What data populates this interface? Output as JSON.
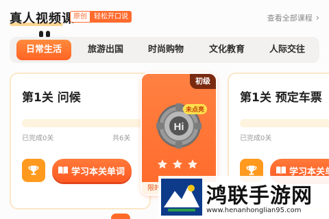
{
  "header": {
    "title": "真人视频课",
    "tag_original": "原创",
    "tag_slogan": "轻松开口说",
    "view_all": "查看全部课程"
  },
  "tabs": [
    {
      "label": "日常生活",
      "active": true
    },
    {
      "label": "旅游出国",
      "active": false
    },
    {
      "label": "时尚购物",
      "active": false
    },
    {
      "label": "文化教育",
      "active": false
    },
    {
      "label": "人际交往",
      "active": false
    }
  ],
  "lessons": [
    {
      "title": "第1关  问候",
      "progress": 0,
      "done_text": "已完成0关",
      "total_text": "共6关",
      "study_label": "学习本关单词"
    },
    {
      "title": "第1关  预定车票",
      "progress": 0,
      "done_text": "已完成0关",
      "study_label": "学习本关单"
    }
  ],
  "level_card": {
    "tag": "初级",
    "badge_text": "Hi",
    "status_label": "未点亮",
    "stars_total": 3,
    "bottom_text": "限时"
  },
  "watermark": {
    "title": "鸿联手游网",
    "url": "www.henanhonglian95.com"
  },
  "colors": {
    "accent": "#ff6a2c",
    "gold": "#ffb43a"
  }
}
